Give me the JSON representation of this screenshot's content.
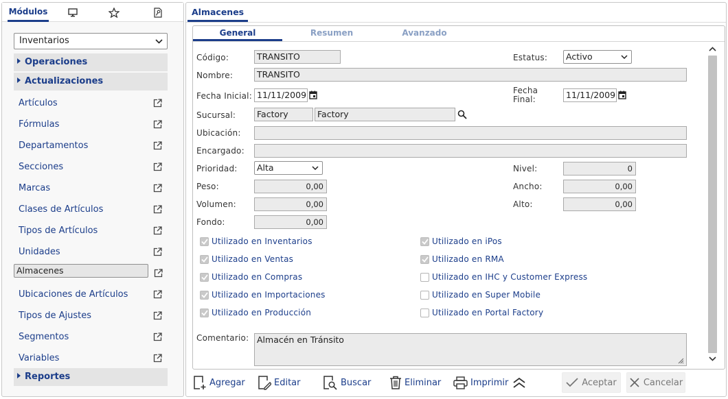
{
  "sidebar": {
    "tabs": {
      "modules": "Módulos",
      "screen_icon": "monitor-icon",
      "star_icon": "star-icon",
      "report_icon": "document-key-icon"
    },
    "module_select": "Inventarios",
    "groups": {
      "operaciones": "Operaciones",
      "actualizaciones": "Actualizaciones",
      "reportes": "Reportes"
    },
    "items": [
      "Artículos",
      "Fórmulas",
      "Departamentos",
      "Secciones",
      "Marcas",
      "Clases de Artículos",
      "Tipos de Artículos",
      "Unidades",
      "Almacenes",
      "Ubicaciones de Artículos",
      "Tipos de Ajustes",
      "Segmentos",
      "Variables"
    ],
    "selected_item": "Almacenes"
  },
  "main": {
    "tab": "Almacenes",
    "subtabs": [
      "General",
      "Resumen",
      "Avanzado"
    ],
    "labels": {
      "codigo": "Código:",
      "estatus": "Estatus:",
      "nombre": "Nombre:",
      "fecha_inicial": "Fecha Inicial:",
      "fecha_final_1": "Fecha",
      "fecha_final_2": "Final:",
      "sucursal": "Sucursal:",
      "ubicacion": "Ubicación:",
      "encargado": "Encargado:",
      "prioridad": "Prioridad:",
      "nivel": "Nivel:",
      "peso": "Peso:",
      "ancho": "Ancho:",
      "volumen": "Volumen:",
      "alto": "Alto:",
      "fondo": "Fondo:",
      "comentario": "Comentario:"
    },
    "values": {
      "codigo": "TRANSITO",
      "estatus": "Activo",
      "nombre": "TRANSITO",
      "fecha_inicial": "11/11/2009",
      "fecha_final": "11/11/2009",
      "sucursal_code": "Factory",
      "sucursal_name": "Factory",
      "ubicacion": "",
      "encargado": "",
      "prioridad": "Alta",
      "nivel": "0",
      "peso": "0,00",
      "ancho": "0,00",
      "volumen": "0,00",
      "alto": "0,00",
      "fondo": "0,00",
      "comentario": "Almacén en Tránsito"
    },
    "checkboxes": {
      "inventarios": {
        "label": "Utilizado en Inventarios",
        "checked": true
      },
      "ventas": {
        "label": "Utilizado en Ventas",
        "checked": true
      },
      "compras": {
        "label": "Utilizado en Compras",
        "checked": true
      },
      "importaciones": {
        "label": "Utilizado en Importaciones",
        "checked": true
      },
      "produccion": {
        "label": "Utilizado en Producción",
        "checked": true
      },
      "ipos": {
        "label": "Utilizado en iPos",
        "checked": true
      },
      "rma": {
        "label": "Utilizado en RMA",
        "checked": true
      },
      "ihc": {
        "label": "Utilizado en IHC y Customer Express",
        "checked": false
      },
      "super_mobile": {
        "label": "Utilizado en Super Mobile",
        "checked": false
      },
      "portal_factory": {
        "label": "Utilizado en Portal Factory",
        "checked": false
      }
    }
  },
  "toolbar": {
    "agregar": "Agregar",
    "editar": "Editar",
    "buscar": "Buscar",
    "eliminar": "Eliminar",
    "imprimir": "Imprimir",
    "aceptar": "Aceptar",
    "cancelar": "Cancelar"
  },
  "colors": {
    "accent": "#1b3d8a",
    "field_bg": "#ebebeb",
    "disabled_text": "#777777"
  }
}
